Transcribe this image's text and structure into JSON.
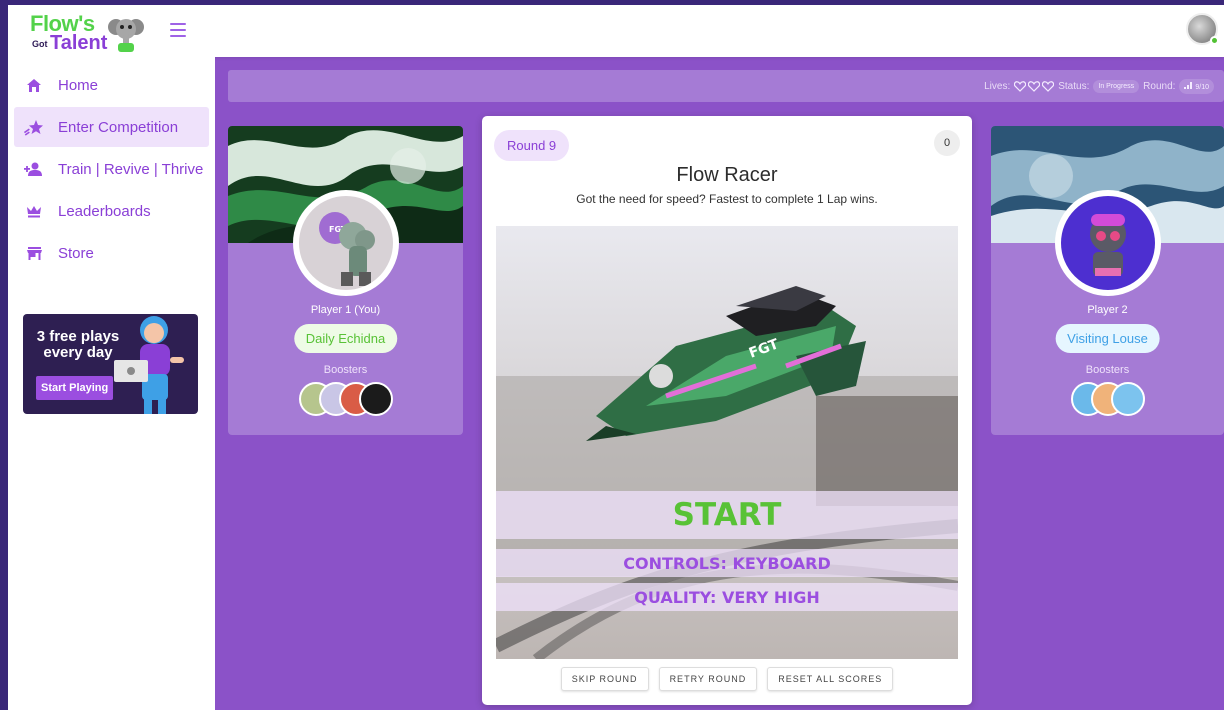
{
  "brand": {
    "line1": "Flow's",
    "line2_small": "Got",
    "line2_big": "Talent"
  },
  "nav": [
    {
      "label": "Home",
      "icon": "home-icon",
      "active": false
    },
    {
      "label": "Enter Competition",
      "icon": "sparkle-star-icon",
      "active": true
    },
    {
      "label": "Train | Revive | Thrive",
      "icon": "users-plus-icon",
      "active": false
    },
    {
      "label": "Leaderboards",
      "icon": "crown-icon",
      "active": false
    },
    {
      "label": "Store",
      "icon": "store-icon",
      "active": false
    }
  ],
  "promo": {
    "title": "3 free plays every day",
    "button": "Start Playing"
  },
  "status": {
    "lives_label": "Lives:",
    "lives": 3,
    "status_label": "Status:",
    "status_value": "In Progress",
    "round_label": "Round:",
    "round_value": "9/10"
  },
  "player1": {
    "name": "Player 1 (You)",
    "pill": "Daily Echidna",
    "boosters_label": "Boosters"
  },
  "player2": {
    "name": "Player 2",
    "pill": "Visiting Louse",
    "boosters_label": "Boosters"
  },
  "game": {
    "round_badge": "Round 9",
    "score": "0",
    "title": "Flow Racer",
    "description": "Got the need for speed? Fastest to complete 1 Lap wins.",
    "start": "START",
    "controls": "CONTROLS: KEYBOARD",
    "quality": "QUALITY: VERY HIGH",
    "ship_label": "FGT"
  },
  "buttons": {
    "skip": "SKIP ROUND",
    "retry": "RETRY ROUND",
    "reset": "RESET ALL SCORES"
  },
  "colors": {
    "brand_purple": "#8a3fd6",
    "brand_green": "#53d24a",
    "background": "#8b52c8",
    "start_green": "#58c236"
  }
}
